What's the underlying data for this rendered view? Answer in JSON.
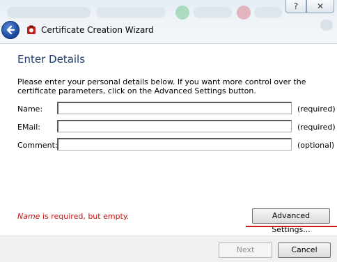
{
  "window": {
    "title": "Certificate Creation Wizard",
    "help_glyph": "?",
    "close_glyph": "✕"
  },
  "page": {
    "heading": "Enter Details",
    "intro": "Please enter your personal details below. If you want more control over the certificate parameters, click on the Advanced Settings button."
  },
  "form": {
    "name": {
      "label": "Name:",
      "value": "",
      "hint": "(required)"
    },
    "email": {
      "label": "EMail:",
      "value": "",
      "hint": "(required)"
    },
    "comment": {
      "label": "Comment:",
      "value": "",
      "hint": "(optional)"
    }
  },
  "validation": {
    "field": "Name",
    "message": " is required, but empty."
  },
  "buttons": {
    "advanced": "Advanced Settings...",
    "next": "Next",
    "cancel": "Cancel"
  },
  "colors": {
    "heading": "#1e3a6e",
    "error": "#cc1111",
    "highlight_line": "#d01616"
  },
  "icons": [
    "back-arrow-icon",
    "app-icon",
    "help-icon",
    "close-icon"
  ]
}
